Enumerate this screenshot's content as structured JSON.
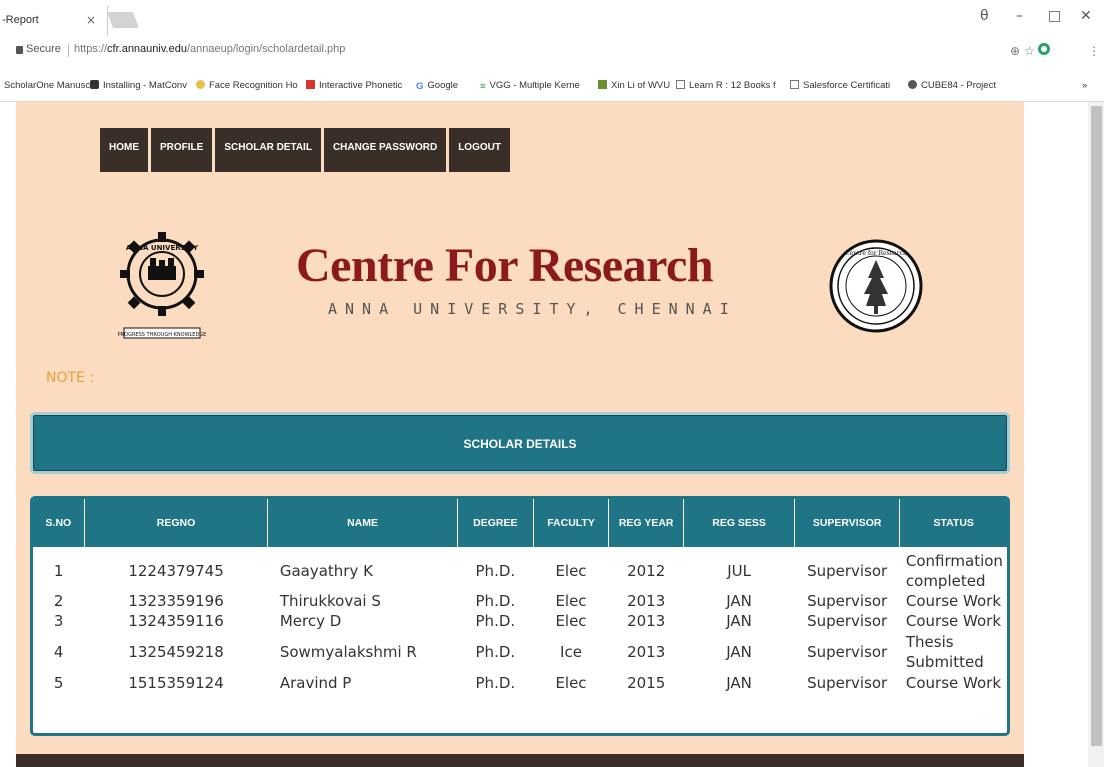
{
  "browser": {
    "tab_title": "-Report",
    "tab_close": "×",
    "window_controls": [
      "θ",
      "–",
      "□",
      "✕"
    ],
    "secure_label": "Secure",
    "url_prefix": "https://",
    "url_host": "cfr.annauniv.edu",
    "url_path": "/annaeup/login/scholardetail.php",
    "bookmarks": [
      "ScholarOne Manuscr",
      "Installing - MatConv",
      "Face Recognition Ho",
      "Interactive Phonetic",
      "Google",
      "VGG - Multiple Kerne",
      "Xin Li of WVU",
      "Learn R : 12 Books f",
      "Salesforce Certificati",
      "CUBE84 - Project"
    ]
  },
  "nav": {
    "items": [
      "HOME",
      "PROFILE",
      "SCHOLAR DETAIL",
      "CHANGE PASSWORD",
      "LOGOUT"
    ]
  },
  "header": {
    "title": "Centre For Research",
    "subtitle": "ANNA UNIVERSITY, CHENNAI",
    "left_logo_text_top": "ANNA UNIVERSITY",
    "left_logo_text_bottom": "PROGRESS THROUGH KNOWLEDGE",
    "right_logo_text": "Centre for Research"
  },
  "note_label": "NOTE :",
  "panel_title": "SCHOLAR DETAILS",
  "table": {
    "columns": [
      "S.NO",
      "REGNO",
      "NAME",
      "DEGREE",
      "FACULTY",
      "REG YEAR",
      "REG SESS",
      "SUPERVISOR",
      "STATUS"
    ],
    "rows": [
      [
        "1",
        "1224379745",
        "Gaayathry K",
        "Ph.D.",
        "Elec",
        "2012",
        "JUL",
        "Supervisor",
        "Confirmation completed"
      ],
      [
        "2",
        "1323359196",
        "Thirukkovai S",
        "Ph.D.",
        "Elec",
        "2013",
        "JAN",
        "Supervisor",
        "Course Work"
      ],
      [
        "3",
        "1324359116",
        "Mercy D",
        "Ph.D.",
        "Elec",
        "2013",
        "JAN",
        "Supervisor",
        "Course Work"
      ],
      [
        "4",
        "1325459218",
        "Sowmyalakshmi R",
        "Ph.D.",
        "Ice",
        "2013",
        "JAN",
        "Supervisor",
        "Thesis Submitted"
      ],
      [
        "5",
        "1515359124",
        "Aravind P",
        "Ph.D.",
        "Elec",
        "2015",
        "JAN",
        "Supervisor",
        "Course Work"
      ]
    ]
  },
  "colors": {
    "page_bg": "#fcdcc0",
    "nav_bg": "#3a2f28",
    "teal": "#1f7486",
    "title_red": "#8b1a1c",
    "note_orange": "#e6a23c"
  }
}
